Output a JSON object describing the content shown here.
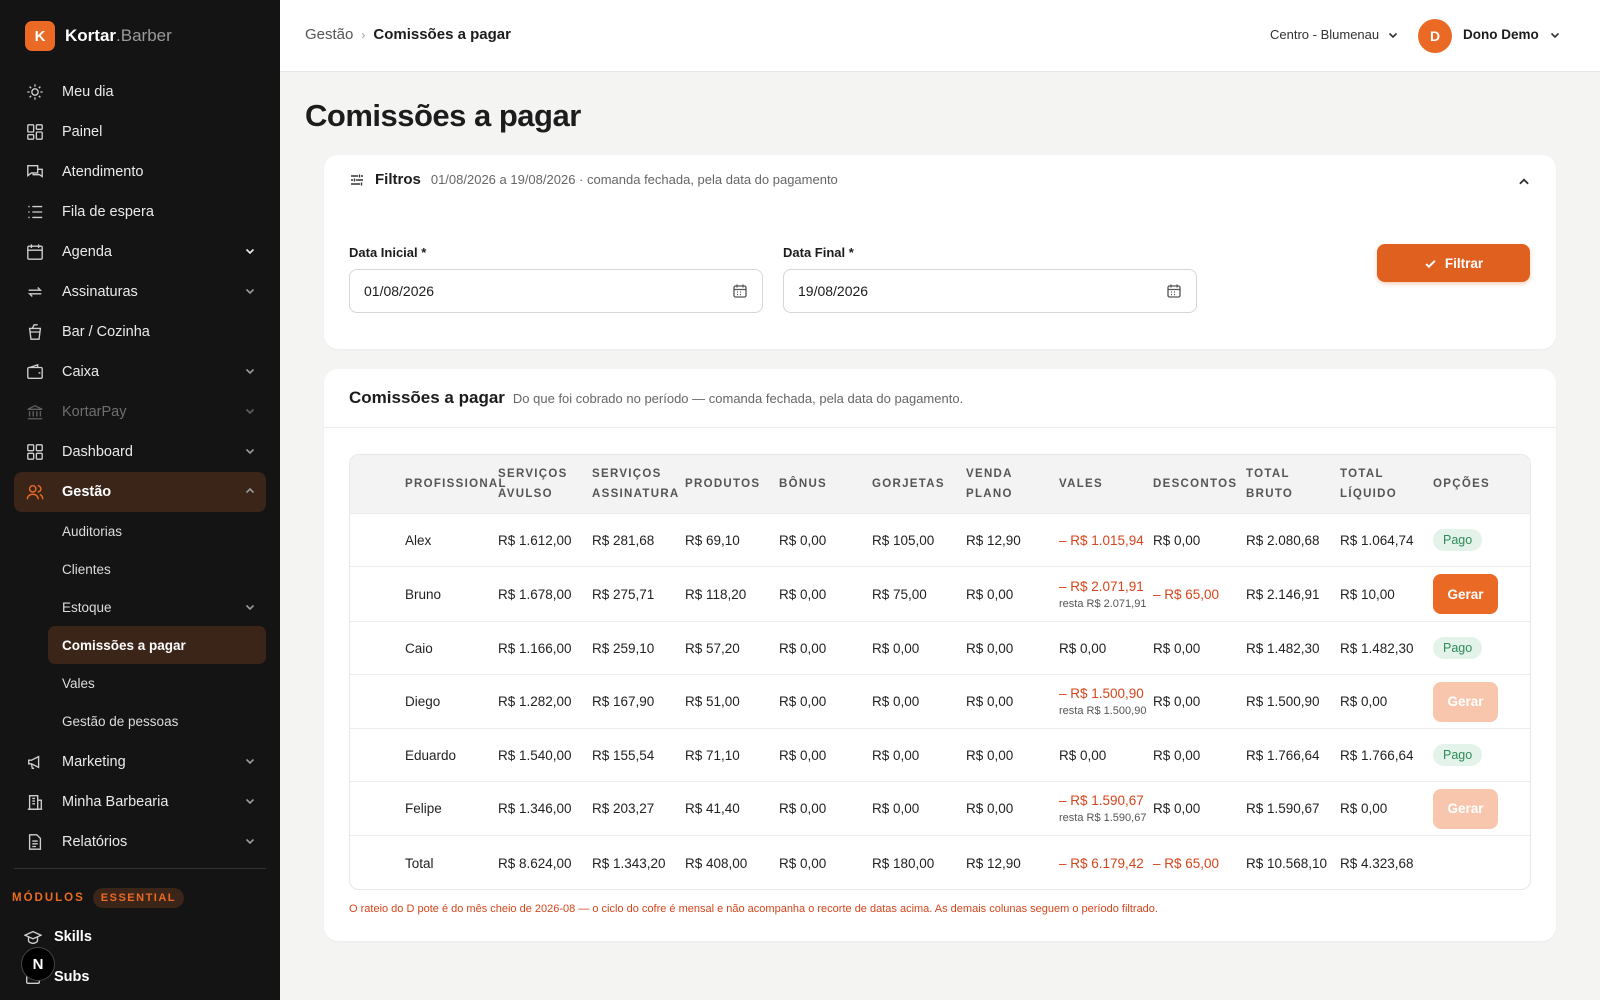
{
  "brand": {
    "badge": "K",
    "name": "Kortar",
    "suffix": ".Barber"
  },
  "sidebar": {
    "items": [
      {
        "label": "Meu dia",
        "icon": "sun-icon"
      },
      {
        "label": "Painel",
        "icon": "grid-icon"
      },
      {
        "label": "Atendimento",
        "icon": "chat-icon"
      },
      {
        "label": "Fila de espera",
        "icon": "list-icon"
      },
      {
        "label": "Agenda",
        "icon": "calendar-icon"
      },
      {
        "label": "Assinaturas",
        "icon": "repeat-icon"
      },
      {
        "label": "Bar / Cozinha",
        "icon": "cup-icon"
      },
      {
        "label": "Caixa",
        "icon": "wallet-icon"
      },
      {
        "label": "KortarPay",
        "icon": "bank-icon"
      },
      {
        "label": "Dashboard",
        "icon": "dashboard-icon"
      },
      {
        "label": "Gestão",
        "icon": "users-icon"
      }
    ],
    "sub": [
      {
        "label": "Auditorias"
      },
      {
        "label": "Clientes"
      },
      {
        "label": "Estoque"
      },
      {
        "label": "Comissões a pagar"
      },
      {
        "label": "Vales"
      },
      {
        "label": "Gestão de pessoas"
      }
    ],
    "after": [
      {
        "label": "Marketing",
        "icon": "megaphone-icon"
      },
      {
        "label": "Minha Barbearia",
        "icon": "building-icon"
      },
      {
        "label": "Relatórios",
        "icon": "report-icon"
      }
    ],
    "modules_label": "MÓDULOS",
    "modules_badge": "ESSENTIAL",
    "modules": [
      {
        "label": "Skills"
      },
      {
        "label": "Subs"
      }
    ],
    "n_badge": "N"
  },
  "topbar": {
    "crumb_parent": "Gestão",
    "crumb_sep": "›",
    "crumb_current": "Comissões a pagar",
    "location": "Centro - Blumenau",
    "avatar": "D",
    "user": "Dono Demo"
  },
  "page_title": "Comissões a pagar",
  "filters": {
    "title": "Filtros",
    "summary": "01/08/2026 a 19/08/2026 · comanda fechada, pela data do pagamento",
    "start_label": "Data Inicial *",
    "start_value": "01/08/2026",
    "end_label": "Data Final *",
    "end_value": "19/08/2026",
    "button": "Filtrar"
  },
  "table": {
    "title": "Comissões a pagar",
    "subtitle": "Do que foi cobrado no período — comanda fechada, pela data do pagamento.",
    "headers": [
      "PROFISSIONAL",
      "SERVIÇOS AVULSO",
      "SERVIÇOS ASSINATURA",
      "PRODUTOS",
      "BÔNUS",
      "GORJETAS",
      "VENDA PLANO",
      "VALES",
      "DESCONTOS",
      "TOTAL BRUTO",
      "TOTAL LÍQUIDO",
      "OPÇÕES"
    ],
    "rows": [
      {
        "name": "Alex",
        "avulso": "R$ 1.612,00",
        "assinatura": "R$ 281,68",
        "produtos": "R$ 69,10",
        "bonus": "R$ 0,00",
        "gorjetas": "R$ 105,00",
        "plano": "R$ 12,90",
        "vales": "– R$ 1.015,94",
        "vales_rest": "",
        "descontos": "R$ 0,00",
        "bruto": "R$ 2.080,68",
        "liquido": "R$ 1.064,74",
        "opcao": "Pago"
      },
      {
        "name": "Bruno",
        "avulso": "R$ 1.678,00",
        "assinatura": "R$ 275,71",
        "produtos": "R$ 118,20",
        "bonus": "R$ 0,00",
        "gorjetas": "R$ 75,00",
        "plano": "R$ 0,00",
        "vales": "– R$ 2.071,91",
        "vales_rest": "resta R$ 2.071,91",
        "descontos": "– R$ 65,00",
        "bruto": "R$ 2.146,91",
        "liquido": "R$ 10,00",
        "opcao": "Gerar"
      },
      {
        "name": "Caio",
        "avulso": "R$ 1.166,00",
        "assinatura": "R$ 259,10",
        "produtos": "R$ 57,20",
        "bonus": "R$ 0,00",
        "gorjetas": "R$ 0,00",
        "plano": "R$ 0,00",
        "vales": "R$ 0,00",
        "vales_rest": "",
        "descontos": "R$ 0,00",
        "bruto": "R$ 1.482,30",
        "liquido": "R$ 1.482,30",
        "opcao": "Pago"
      },
      {
        "name": "Diego",
        "avulso": "R$ 1.282,00",
        "assinatura": "R$ 167,90",
        "produtos": "R$ 51,00",
        "bonus": "R$ 0,00",
        "gorjetas": "R$ 0,00",
        "plano": "R$ 0,00",
        "vales": "– R$ 1.500,90",
        "vales_rest": "resta R$ 1.500,90",
        "descontos": "R$ 0,00",
        "bruto": "R$ 1.500,90",
        "liquido": "R$ 0,00",
        "opcao": "Gerar"
      },
      {
        "name": "Eduardo",
        "avulso": "R$ 1.540,00",
        "assinatura": "R$ 155,54",
        "produtos": "R$ 71,10",
        "bonus": "R$ 0,00",
        "gorjetas": "R$ 0,00",
        "plano": "R$ 0,00",
        "vales": "R$ 0,00",
        "vales_rest": "",
        "descontos": "R$ 0,00",
        "bruto": "R$ 1.766,64",
        "liquido": "R$ 1.766,64",
        "opcao": "Pago"
      },
      {
        "name": "Felipe",
        "avulso": "R$ 1.346,00",
        "assinatura": "R$ 203,27",
        "produtos": "R$ 41,40",
        "bonus": "R$ 0,00",
        "gorjetas": "R$ 0,00",
        "plano": "R$ 0,00",
        "vales": "– R$ 1.590,67",
        "vales_rest": "resta R$ 1.590,67",
        "descontos": "R$ 0,00",
        "bruto": "R$ 1.590,67",
        "liquido": "R$ 0,00",
        "opcao": "Gerar"
      }
    ],
    "total": {
      "name": "Total",
      "avulso": "R$ 8.624,00",
      "assinatura": "R$ 1.343,20",
      "produtos": "R$ 408,00",
      "bonus": "R$ 0,00",
      "gorjetas": "R$ 180,00",
      "plano": "R$ 12,90",
      "vales": "– R$ 6.179,42",
      "descontos": "– R$ 65,00",
      "bruto": "R$ 10.568,10",
      "liquido": "R$ 4.323,68"
    },
    "footnote": "O rateio do D pote é do mês cheio de 2026-08 — o ciclo do cofre é mensal e não acompanha o recorte de datas acima. As demais colunas seguem o período filtrado."
  },
  "colors": {
    "accent": "#ea6a25",
    "sidebar_bg": "#141414",
    "negative": "#d5451b",
    "success": "#2e8a57"
  }
}
